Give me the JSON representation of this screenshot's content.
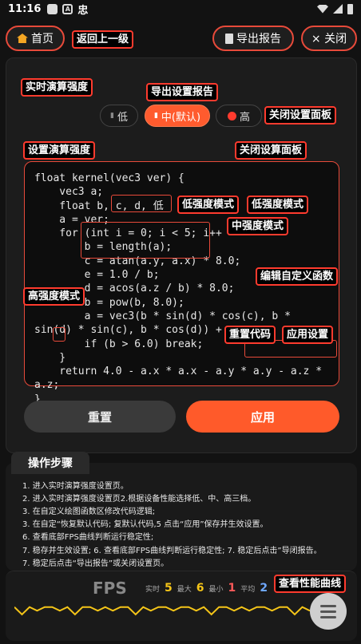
{
  "status": {
    "time": "11:16",
    "app_glyph": "忠"
  },
  "nav": {
    "home": "首页",
    "back": "返回上一级",
    "export": "导出报告",
    "close": "× 关闭"
  },
  "settings": {
    "strength_label": "实时演算强度",
    "export_label": "导出设置报告",
    "close_panel_label": "关闭设置面板",
    "set_strength_label": "设置演算强度",
    "close_calc_label": "关闭设算面板",
    "options": [
      "低",
      "中(默认)",
      "高"
    ],
    "selected": "中(默认)"
  },
  "code": {
    "lines": [
      "float kernel(vec3 ver) {",
      "    vec3 a;",
      "    float b, c, d, 低",
      "    a = ver;",
      "    for (int i = 0; i < 5; i++",
      "        b = length(a);",
      "        c = atan(a.y, a.x) * 8.0;",
      "        e = 1.0 / b;",
      "        d = acos(a.z / b) * 8.0;",
      "        b = pow(b, 8.0);",
      "        a = vec3(b * sin(d) * cos(c), b *",
      "sin(d) * sin(c), b * cos(d)) + ver;",
      "        if (b > 6.0) break;",
      "    }",
      "    return 4.0 - a.x * a.x - a.y * a.y - a.z *",
      "a.z;",
      "}"
    ],
    "annotations": {
      "low1": "低强度模式",
      "low2": "低强度模式",
      "mid": "中强度模式",
      "high": "高强度模式",
      "edit": "编辑自定义函数",
      "reset_code": "重置代码",
      "apply_settings": "应用设置"
    }
  },
  "buttons": {
    "reset": "重置",
    "apply": "应用"
  },
  "steps": {
    "title": "操作步骤",
    "items": [
      "1. 进入实时演算强度设置页。",
      "2. 进入实时演算强度设置页2.根据设备性能选择低、中、高三档。",
      "3. 在自定义绘图函数区修改代码逻辑;",
      "3. 在自定“恢复默认代码; 复默认代码,5 点击“应用”保存并生效设置。",
      "6. 查看底部FPS曲线判断运行稳定性;",
      "7. 稳存并生效设置; 6. 查看底部FPS曲线判断运行稳定性; 7. 稳定后点击”导闭报告。",
      "7. 稳定后点击“导出报告”或关闭设置页。"
    ]
  },
  "fps": {
    "title": "FPS",
    "realtime_label": "实时",
    "realtime": "5",
    "max_label": "最大",
    "max": "6",
    "min_label": "最小",
    "min": "1",
    "avg_label": "平均",
    "avg": "2",
    "curve_label": "查看性能曲线",
    "colors": {
      "realtime": "#f5c518",
      "max": "#f5c518",
      "min": "#ff5a5a",
      "avg": "#6fa8ff",
      "curve": "#f5c518"
    },
    "curve": [
      5,
      3,
      5,
      4,
      5,
      5,
      4,
      5,
      3,
      5,
      5,
      4,
      5,
      4,
      5,
      5,
      3,
      5,
      4,
      5,
      5,
      4,
      5,
      5,
      4,
      5,
      3,
      5,
      5,
      4,
      5,
      4,
      5,
      5,
      4,
      5,
      5,
      3,
      5,
      4
    ]
  }
}
